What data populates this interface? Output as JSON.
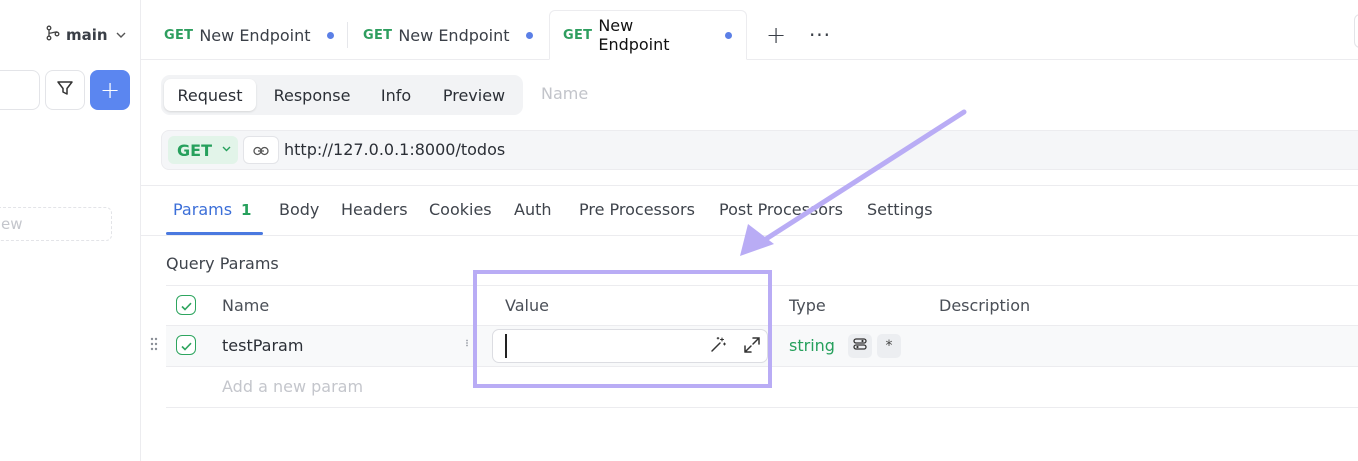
{
  "sidebar": {
    "branch_label": "main",
    "new_item_placeholder": "ew",
    "add_button_label": "+"
  },
  "tabs": [
    {
      "method": "GET",
      "label": "New Endpoint"
    },
    {
      "method": "GET",
      "label": "New Endpoint"
    },
    {
      "method": "GET",
      "label": "New Endpoint"
    }
  ],
  "tab_add_label": "+",
  "tab_more_label": "···",
  "request_modes": [
    "Request",
    "Response",
    "Info",
    "Preview"
  ],
  "name_placeholder": "Name",
  "url_bar": {
    "method": "GET",
    "url": "http://127.0.0.1:8000/todos"
  },
  "sub_tabs": {
    "params_label": "Params",
    "params_count": "1",
    "others": [
      "Body",
      "Headers",
      "Cookies",
      "Auth",
      "Pre Processors",
      "Post Processors",
      "Settings"
    ]
  },
  "query_params": {
    "title": "Query Params",
    "columns": {
      "name": "Name",
      "value": "Value",
      "type": "Type",
      "description": "Description"
    },
    "rows": [
      {
        "name": "testParam",
        "value": "",
        "type": "string",
        "required_label": "*"
      }
    ],
    "add_placeholder": "Add a new param"
  },
  "colors": {
    "accent_blue": "#5b86f0",
    "method_green": "#26a05c",
    "annotation_purple": "#b9acf5"
  }
}
